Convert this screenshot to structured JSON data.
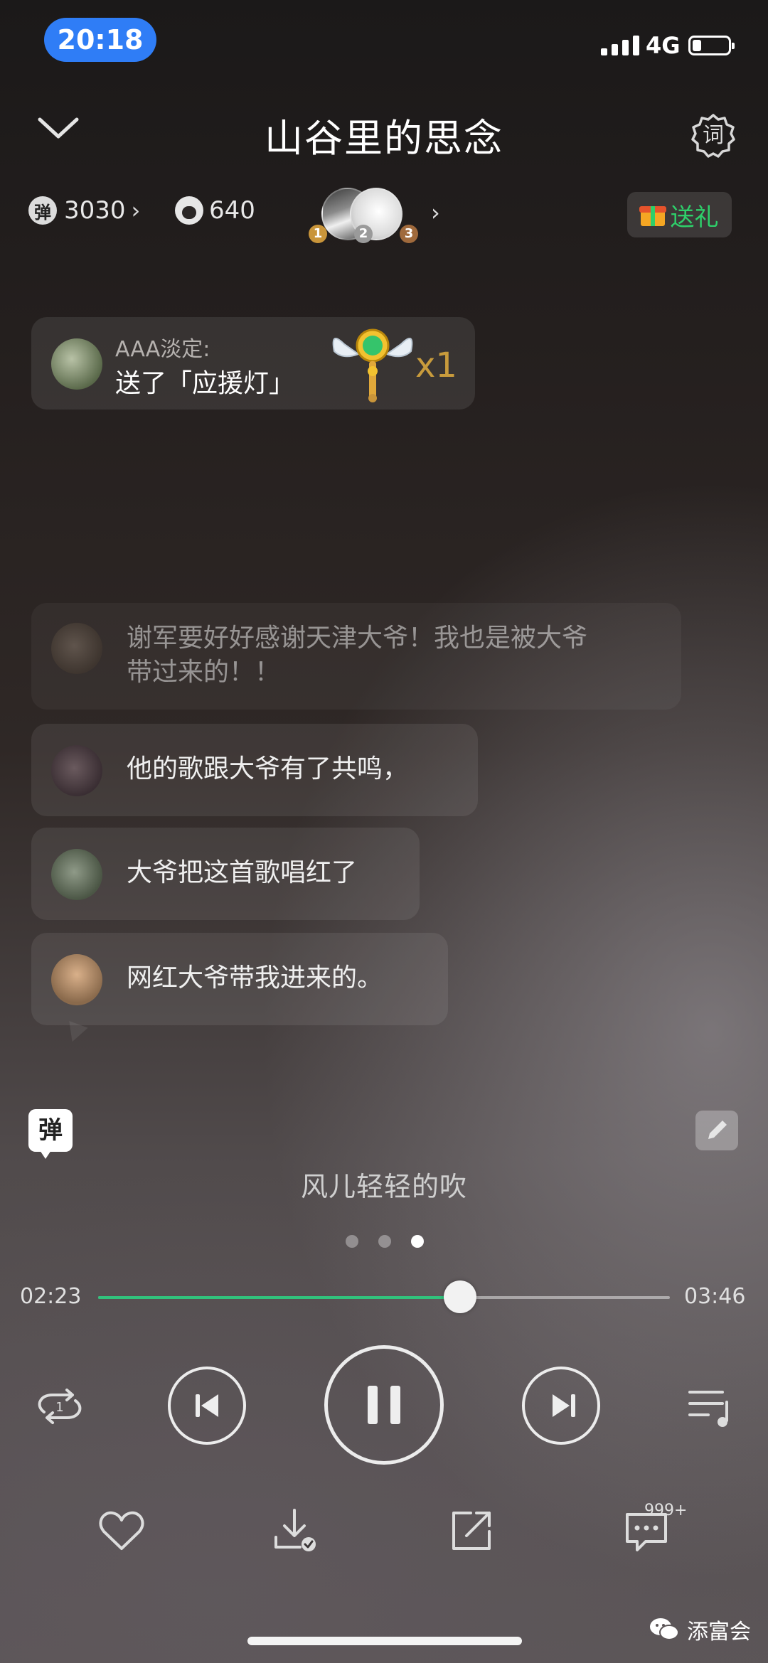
{
  "status_bar": {
    "time": "20:18",
    "network": "4G"
  },
  "header": {
    "title": "山谷里的思念",
    "lyrics_button": "词"
  },
  "stats": {
    "danmaku_badge": "弹",
    "danmaku_count": "3030",
    "listen_count": "640",
    "chevron": "›",
    "rank_badges": [
      "1",
      "2",
      "3"
    ],
    "gift_button": "送礼"
  },
  "gift_notice": {
    "sender": "AAA淡定:",
    "message": "送了「应援灯」",
    "multiplier": "x1"
  },
  "comments": [
    {
      "text_line1": "谢军要好好感谢天津大爷！我也是被大爷",
      "text_line2": "带过来的！！"
    },
    {
      "text": "他的歌跟大爷有了共鸣，"
    },
    {
      "text": "大爷把这首歌唱红了"
    },
    {
      "text": "网红大爷带我进来的。"
    }
  ],
  "danmaku_toggle": "弹",
  "lyric_line": "风儿轻轻的吹",
  "pager": {
    "pages": 3,
    "active": 3
  },
  "player": {
    "current_time": "02:23",
    "total_time": "03:46",
    "progress": 0.633,
    "state": "playing",
    "repeat_mode": "1"
  },
  "actions": {
    "comment_count": "999+"
  },
  "watermark": "添富会",
  "colors": {
    "accent": "#31c27c",
    "gift_green": "#2ecf6a",
    "time_pill": "#2f7df6",
    "gold": "#c89b3c"
  }
}
